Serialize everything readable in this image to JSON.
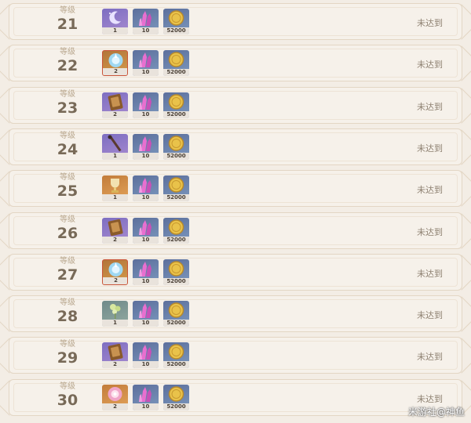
{
  "rows": [
    {
      "level_label": "等级",
      "level": "21",
      "rewards": [
        {
          "icon": "moon-crescent-item-icon",
          "count": "1",
          "rarity": "purple"
        },
        {
          "icon": "crystal-icon",
          "count": "10",
          "rarity": "blue"
        },
        {
          "icon": "coin-icon",
          "count": "52000",
          "rarity": "blue"
        }
      ],
      "status": "未达到"
    },
    {
      "level_label": "等级",
      "level": "22",
      "rewards": [
        {
          "icon": "gem-icon",
          "count": "2",
          "rarity": "gold"
        },
        {
          "icon": "crystal-icon",
          "count": "10",
          "rarity": "blue"
        },
        {
          "icon": "coin-icon",
          "count": "52000",
          "rarity": "blue"
        }
      ],
      "status": "未达到"
    },
    {
      "level_label": "等级",
      "level": "23",
      "rewards": [
        {
          "icon": "book-icon",
          "count": "2",
          "rarity": "purple"
        },
        {
          "icon": "crystal-icon",
          "count": "10",
          "rarity": "blue"
        },
        {
          "icon": "coin-icon",
          "count": "52000",
          "rarity": "blue"
        }
      ],
      "status": "未达到"
    },
    {
      "level_label": "等级",
      "level": "24",
      "rewards": [
        {
          "icon": "wand-icon",
          "count": "1",
          "rarity": "purple"
        },
        {
          "icon": "crystal-icon",
          "count": "10",
          "rarity": "blue"
        },
        {
          "icon": "coin-icon",
          "count": "52000",
          "rarity": "blue"
        }
      ],
      "status": "未达到"
    },
    {
      "level_label": "等级",
      "level": "25",
      "rewards": [
        {
          "icon": "trophy-icon",
          "count": "1",
          "rarity": "orange"
        },
        {
          "icon": "crystal-icon",
          "count": "10",
          "rarity": "blue"
        },
        {
          "icon": "coin-icon",
          "count": "52000",
          "rarity": "blue"
        }
      ],
      "status": "未达到"
    },
    {
      "level_label": "等级",
      "level": "26",
      "rewards": [
        {
          "icon": "book-icon",
          "count": "2",
          "rarity": "purple"
        },
        {
          "icon": "crystal-icon",
          "count": "10",
          "rarity": "blue"
        },
        {
          "icon": "coin-icon",
          "count": "52000",
          "rarity": "blue"
        }
      ],
      "status": "未达到"
    },
    {
      "level_label": "等级",
      "level": "27",
      "rewards": [
        {
          "icon": "gem-icon",
          "count": "2",
          "rarity": "gold"
        },
        {
          "icon": "crystal-icon",
          "count": "10",
          "rarity": "blue"
        },
        {
          "icon": "coin-icon",
          "count": "52000",
          "rarity": "blue"
        }
      ],
      "status": "未达到"
    },
    {
      "level_label": "等级",
      "level": "28",
      "rewards": [
        {
          "icon": "plant-icon",
          "count": "1",
          "rarity": "green"
        },
        {
          "icon": "crystal-icon",
          "count": "10",
          "rarity": "blue"
        },
        {
          "icon": "coin-icon",
          "count": "52000",
          "rarity": "blue"
        }
      ],
      "status": "未达到"
    },
    {
      "level_label": "等级",
      "level": "29",
      "rewards": [
        {
          "icon": "book-icon",
          "count": "2",
          "rarity": "purple"
        },
        {
          "icon": "crystal-icon",
          "count": "10",
          "rarity": "blue"
        },
        {
          "icon": "coin-icon",
          "count": "52000",
          "rarity": "blue"
        }
      ],
      "status": "未达到"
    },
    {
      "level_label": "等级",
      "level": "30",
      "rewards": [
        {
          "icon": "flower-gem-icon",
          "count": "2",
          "rarity": "orange"
        },
        {
          "icon": "crystal-icon",
          "count": "10",
          "rarity": "blue"
        },
        {
          "icon": "coin-icon",
          "count": "52000",
          "rarity": "blue"
        }
      ],
      "status": "未达到"
    }
  ],
  "watermark": "米游社@神鱼"
}
